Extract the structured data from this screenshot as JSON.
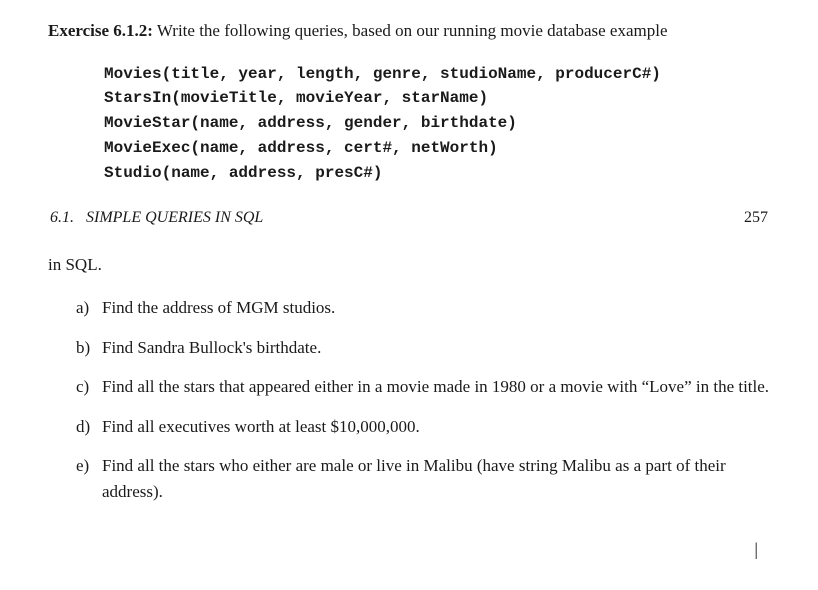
{
  "exercise": {
    "label": "Exercise 6.1.2:",
    "prompt": "Write the following queries, based on our running movie database example"
  },
  "schema": {
    "lines": [
      "Movies(title, year, length, genre, studioName, producerC#)",
      "StarsIn(movieTitle, movieYear, starName)",
      "MovieStar(name, address, gender, birthdate)",
      "MovieExec(name, address, cert#, netWorth)",
      "Studio(name, address, presC#)"
    ]
  },
  "section": {
    "number": "6.1.",
    "title": "SIMPLE QUERIES IN SQL",
    "page": "257"
  },
  "in_sql": "in SQL.",
  "questions": [
    {
      "label": "a)",
      "text": "Find the address of MGM studios."
    },
    {
      "label": "b)",
      "text": "Find Sandra Bullock's birthdate."
    },
    {
      "label": "c)",
      "text": "Find all the stars that appeared either in a movie made in 1980 or a movie with “Love” in the title."
    },
    {
      "label": "d)",
      "text": "Find all executives worth at least $10,000,000."
    },
    {
      "label": "e)",
      "text": "Find all the stars who either are male or live in Malibu (have string Malibu as a part of their address)."
    }
  ],
  "cursor": "|"
}
